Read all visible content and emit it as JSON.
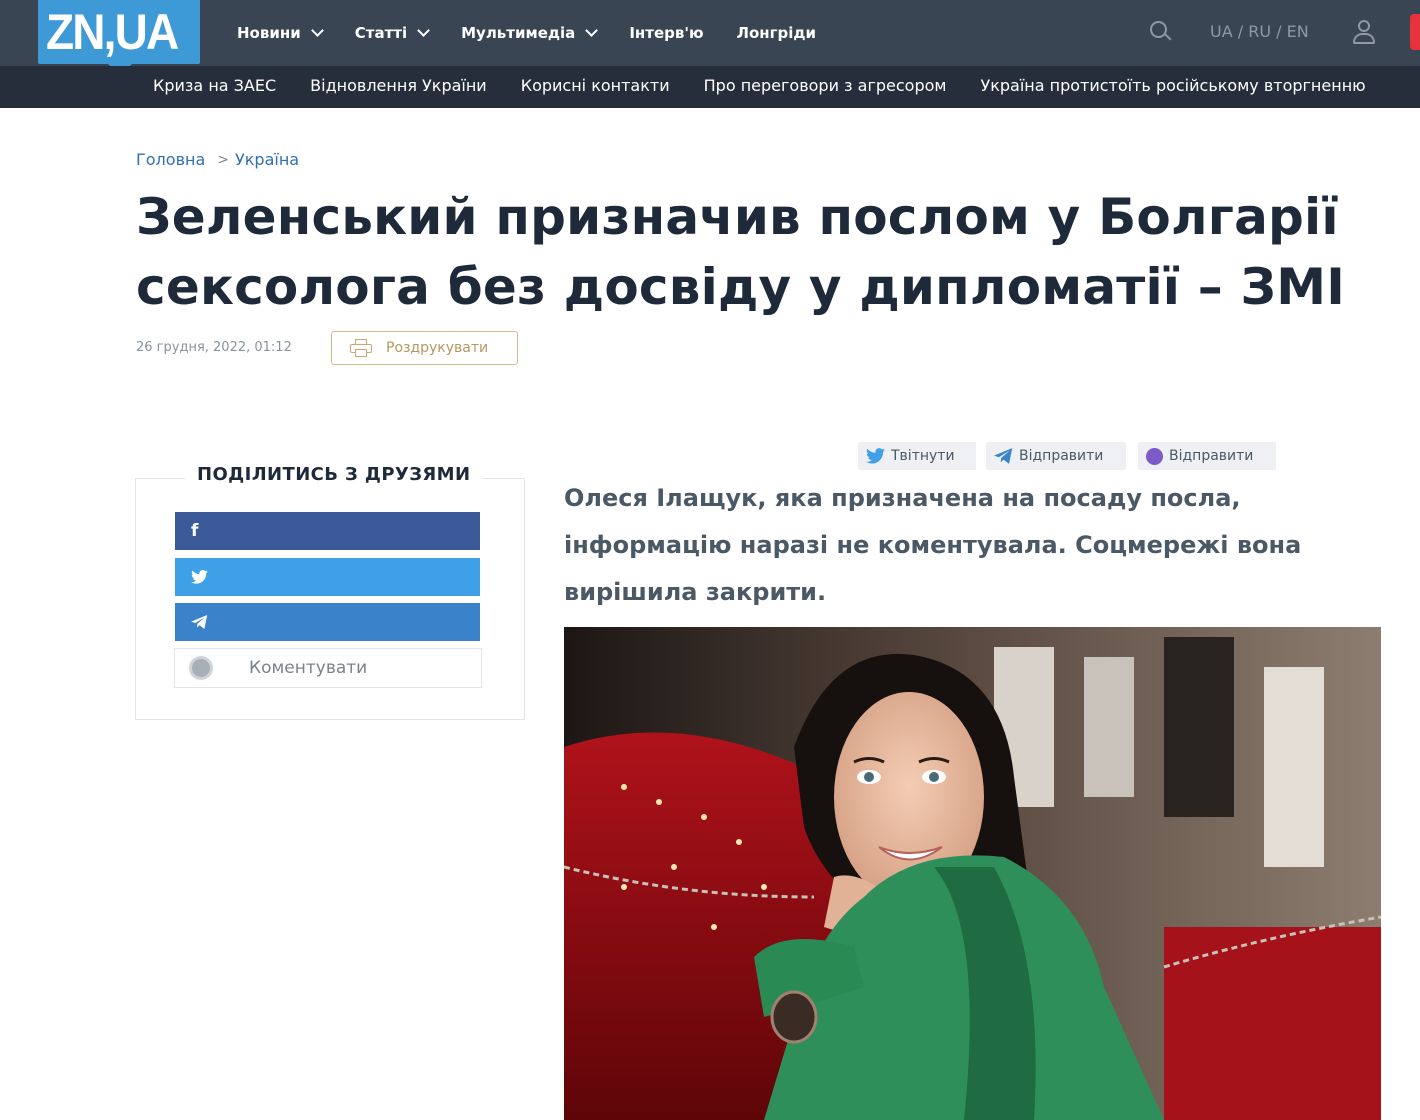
{
  "header": {
    "logo": "ZN,UA",
    "nav": [
      {
        "label": "Новини",
        "has_dropdown": true
      },
      {
        "label": "Статті",
        "has_dropdown": true
      },
      {
        "label": "Мультимедіа",
        "has_dropdown": true
      },
      {
        "label": "Інтерв'ю",
        "has_dropdown": false
      },
      {
        "label": "Лонгріди",
        "has_dropdown": false
      }
    ],
    "languages": "UA / RU / EN",
    "icons": {
      "search": "search-icon",
      "user": "user-icon"
    }
  },
  "topics": [
    "Криза на ЗАЕС",
    "Відновлення України",
    "Корисні контакти",
    "Про переговори з агресором",
    "Україна протистоїть російському вторгненню"
  ],
  "breadcrumb": {
    "home": "Головна",
    "section": "Україна"
  },
  "article": {
    "title": "Зеленський призначив послом у Болгарії сексолога без досвіду у дипломатії – ЗМІ",
    "date": "26 грудня, 2022, 01:12",
    "print_label": "Роздрукувати",
    "lead": "Олеся Ілащук, яка призначена на посаду посла, інформацію наразі не коментувала. Соцмережі вона вирішила закрити."
  },
  "share_box": {
    "title": "ПОДІЛИТИСЬ З ДРУЗЯМИ",
    "facebook_glyph": "f",
    "twitter_glyph": "🐦",
    "telegram_glyph": "➤",
    "comment_label": "Коментувати"
  },
  "share_pills": {
    "twitter": "Твітнути",
    "telegram": "Відправити",
    "viber": "Відправити"
  },
  "colors": {
    "header_bg": "#3a4553",
    "topics_bg": "#252e3a",
    "logo_bg": "#3d9ad6",
    "facebook": "#3b5998",
    "twitter": "#3fa0e8",
    "telegram": "#3a82c9",
    "viber": "#7b5bc8",
    "link": "#2f6fb5",
    "print_accent": "#d9b98a"
  }
}
